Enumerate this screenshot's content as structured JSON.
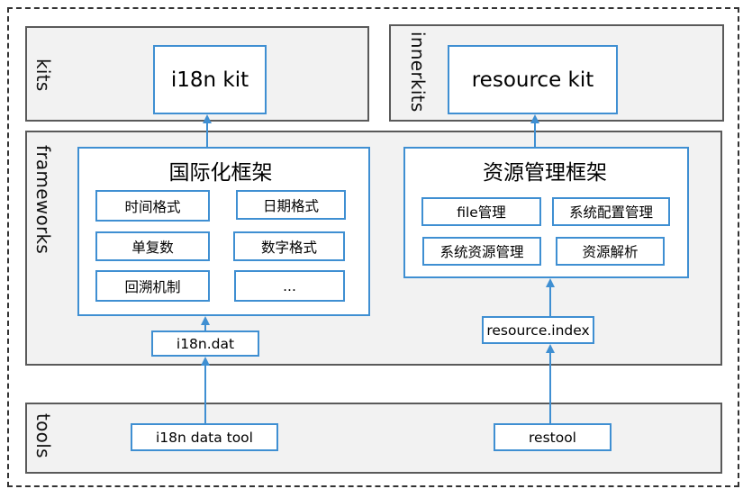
{
  "layers": {
    "kits": "kits",
    "innerkits": "innerkits",
    "frameworks": "frameworks",
    "tools": "tools"
  },
  "kits": {
    "i18n_kit": "i18n kit",
    "resource_kit": "resource kit"
  },
  "i18n_framework": {
    "title": "国际化框架",
    "items": [
      "时间格式",
      "日期格式",
      "单复数",
      "数字格式",
      "回溯机制",
      "..."
    ]
  },
  "resource_framework": {
    "title": "资源管理框架",
    "items": [
      "file管理",
      "系统配置管理",
      "系统资源管理",
      "资源解析"
    ]
  },
  "data_files": {
    "i18n_dat": "i18n.dat",
    "resource_index": "resource.index"
  },
  "tools": {
    "i18n_data_tool": "i18n data tool",
    "restool": "restool"
  },
  "colors": {
    "accent_blue": "#3f8fd2",
    "layer_fill": "#f2f2f2",
    "layer_border": "#5a5a5a"
  }
}
